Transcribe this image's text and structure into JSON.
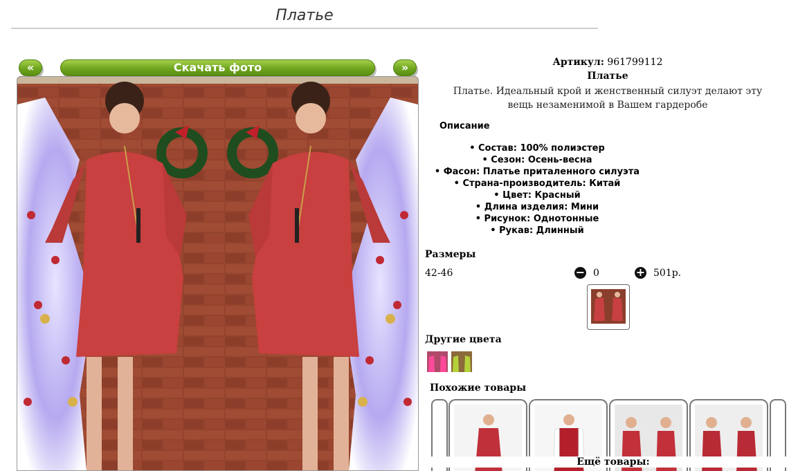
{
  "page": {
    "title": "Платье"
  },
  "photo_nav": {
    "prev_label": "«",
    "download_label": "Скачать фото",
    "next_label": "»"
  },
  "product": {
    "sku_label": "Артикул:",
    "sku_value": "961799112",
    "name": "Платье",
    "description": "Платье. Идеальный крой и женственный силуэт делают эту вещь незаменимой в Вашем гардеробе"
  },
  "details": {
    "heading": "Описание",
    "attributes": [
      "Состав: 100% полиэстер",
      "Сезон: Осень-весна",
      "Фасон: Платье приталенного силуэта",
      "Страна-производитель: Китай",
      "Цвет: Красный",
      "Длина изделия: Мини",
      "Рисунок: Однотонные",
      "Рукав: Длинный"
    ]
  },
  "sizes": {
    "heading": "Размеры",
    "items": [
      {
        "size": "42-46",
        "quantity": "0",
        "price": "501р."
      }
    ],
    "minus_icon": "minus-circle-icon",
    "plus_icon": "plus-circle-icon"
  },
  "other_colors": {
    "heading": "Другие цвета",
    "swatches": [
      "pink",
      "green"
    ]
  },
  "similar": {
    "heading": "Похожие товары",
    "more_label": "Ещё товары:"
  },
  "colors": {
    "accent": "#6fa51e",
    "dress": "#c8403f",
    "brick": "#8a3f2c"
  }
}
